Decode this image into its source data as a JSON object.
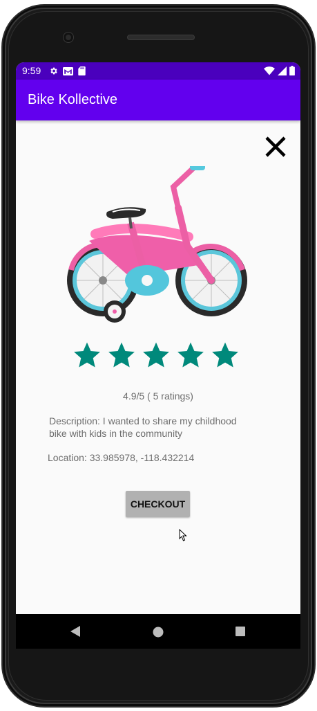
{
  "status_bar": {
    "time": "9:59",
    "left_icons": [
      "gear-icon",
      "gmail-icon",
      "sd-card-icon"
    ],
    "right_icons": [
      "wifi-icon",
      "signal-icon",
      "battery-icon"
    ],
    "color": "#4a00bd"
  },
  "app_bar": {
    "title": "Bike Kollective",
    "color": "#6200ee"
  },
  "listing": {
    "image": "pink-kids-bike-image",
    "rating_stars": 5,
    "rating_max": 5,
    "star_color": "#00897b",
    "rating_text": "4.9/5 ( 5 ratings)",
    "description": "Description: I wanted to share my childhood bike with kids in the community",
    "location": "Location: 33.985978, -118.432214",
    "checkout_label": "CHECKOUT"
  },
  "nav_bar": {
    "buttons": [
      "back-icon",
      "home-icon",
      "recents-icon"
    ]
  }
}
